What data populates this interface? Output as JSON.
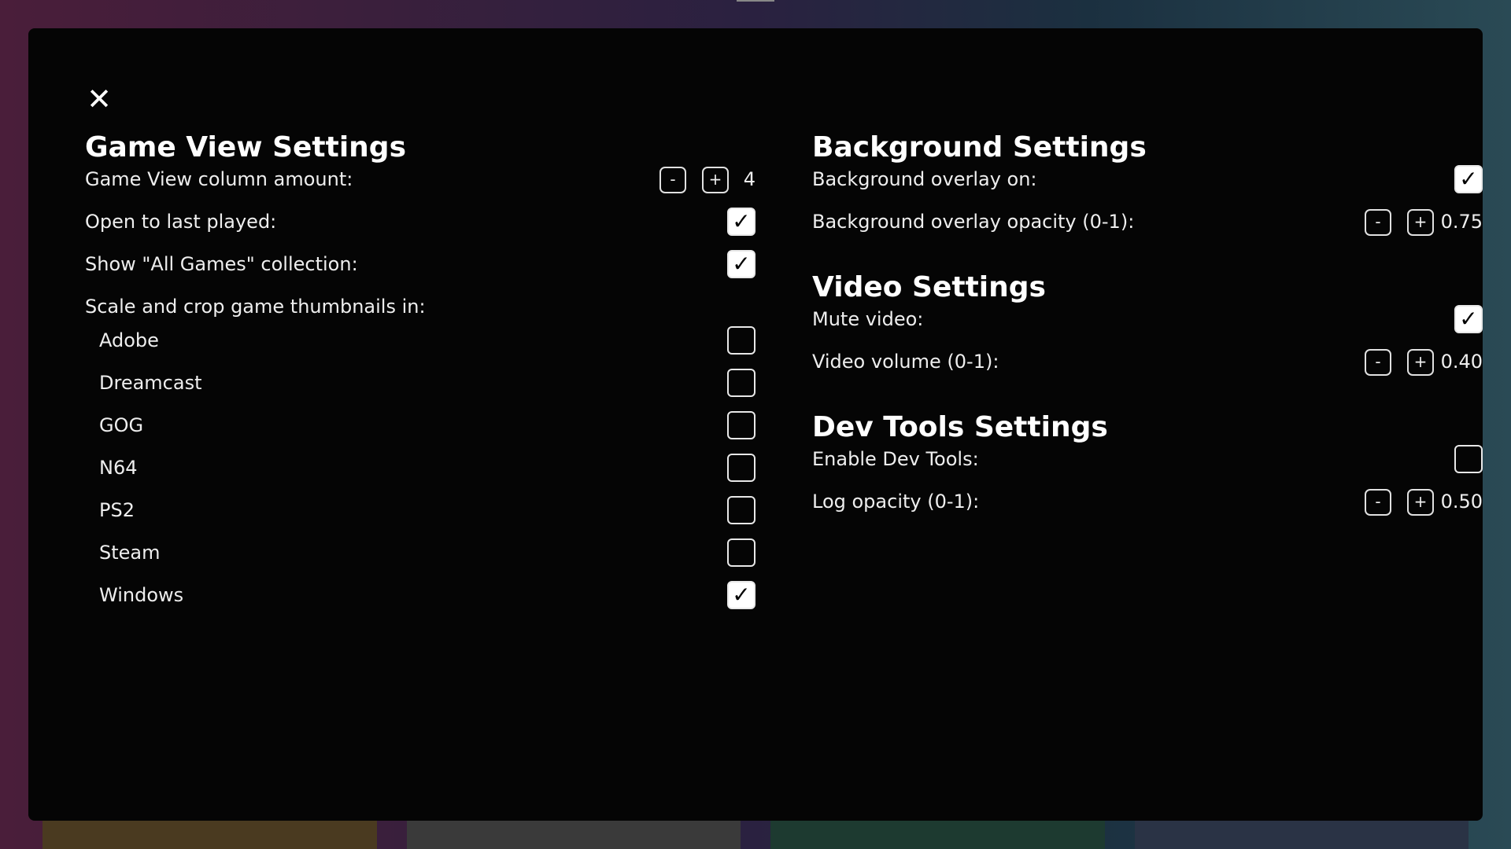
{
  "modal": {
    "close_icon": "✕"
  },
  "game_view": {
    "title": "Game View Settings",
    "column_amount": {
      "label": "Game View column amount:",
      "minus": "-",
      "plus": "+",
      "value": "4"
    },
    "open_last_played": {
      "label": "Open to last played:",
      "checked": true
    },
    "show_all_games": {
      "label": "Show \"All Games\" collection:",
      "checked": true
    },
    "scale_crop_label": "Scale and crop game thumbnails in:",
    "platforms": [
      {
        "label": "Adobe",
        "checked": false
      },
      {
        "label": "Dreamcast",
        "checked": false
      },
      {
        "label": "GOG",
        "checked": false
      },
      {
        "label": "N64",
        "checked": false
      },
      {
        "label": "PS2",
        "checked": false
      },
      {
        "label": "Steam",
        "checked": false
      },
      {
        "label": "Windows",
        "checked": true
      }
    ]
  },
  "background": {
    "title": "Background Settings",
    "overlay_on": {
      "label": "Background overlay on:",
      "checked": true
    },
    "overlay_opacity": {
      "label": "Background overlay opacity (0-1):",
      "minus": "-",
      "plus": "+",
      "value": "0.75"
    }
  },
  "video": {
    "title": "Video Settings",
    "mute": {
      "label": "Mute video:",
      "checked": true
    },
    "volume": {
      "label": "Video volume (0-1):",
      "minus": "-",
      "plus": "+",
      "value": "0.40"
    }
  },
  "dev_tools": {
    "title": "Dev Tools Settings",
    "enable": {
      "label": "Enable Dev Tools:",
      "checked": false
    },
    "log_opacity": {
      "label": "Log opacity (0-1):",
      "minus": "-",
      "plus": "+",
      "value": "0.50"
    }
  },
  "check_glyph": "✓",
  "colors": {
    "modal_bg": "#050505",
    "text": "#eeeeee",
    "checkbox_checked_bg": "#ffffff"
  }
}
